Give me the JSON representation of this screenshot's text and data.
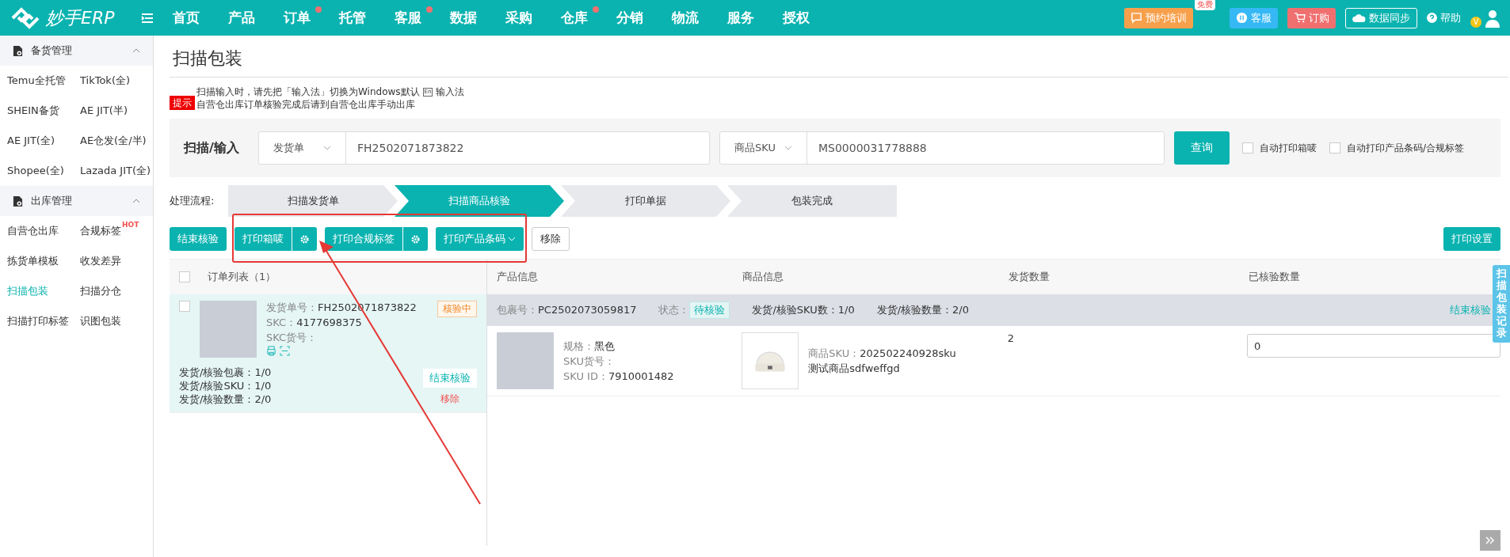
{
  "topbar": {
    "logo": "妙手ERP",
    "nav": [
      {
        "label": "首页",
        "dot": false
      },
      {
        "label": "产品",
        "dot": false
      },
      {
        "label": "订单",
        "dot": true
      },
      {
        "label": "托管",
        "dot": false
      },
      {
        "label": "客服",
        "dot": true
      },
      {
        "label": "数据",
        "dot": false
      },
      {
        "label": "采购",
        "dot": false
      },
      {
        "label": "仓库",
        "dot": true
      },
      {
        "label": "分销",
        "dot": false
      },
      {
        "label": "物流",
        "dot": false
      },
      {
        "label": "服务",
        "dot": false
      },
      {
        "label": "授权",
        "dot": false
      }
    ],
    "training": {
      "label": "预约培训",
      "badge": "免费"
    },
    "service": "客服",
    "order": "订购",
    "sync": "数据同步",
    "help": "帮助",
    "avatar_badge": "V"
  },
  "sidebar": [
    {
      "title": "备货管理",
      "expanded": true,
      "items": [
        {
          "label": "Temu全托管",
          "selected": false
        },
        {
          "label": "TikTok(全)",
          "selected": false
        },
        {
          "label": "SHEIN备货",
          "selected": false
        },
        {
          "label": "AE JIT(半)",
          "selected": false
        },
        {
          "label": "AE JIT(全)",
          "selected": false
        },
        {
          "label": "AE仓发(全/半)",
          "selected": false
        },
        {
          "label": "Shopee(全)",
          "selected": false
        },
        {
          "label": "Lazada JIT(全)",
          "selected": false
        }
      ]
    },
    {
      "title": "出库管理",
      "expanded": true,
      "items": [
        {
          "label": "自营仓出库",
          "selected": false
        },
        {
          "label": "合规标签",
          "selected": false,
          "badge": "HOT"
        },
        {
          "label": "拣货单模板",
          "selected": false
        },
        {
          "label": "收发差异",
          "selected": false
        },
        {
          "label": "扫描包装",
          "selected": true
        },
        {
          "label": "扫描分仓",
          "selected": false
        },
        {
          "label": "扫描打印标签",
          "selected": false
        },
        {
          "label": "识图包装",
          "selected": false
        }
      ]
    }
  ],
  "page_title": "扫描包装",
  "tip": {
    "badge": "提示",
    "line1_before": "扫描输入时，请先把「输入法」切换为Windows默认",
    "ime": "En",
    "line1_after": "输入法",
    "line2": "自营仓出库订单核验完成后请到自营仓出库手动出库"
  },
  "scan": {
    "label": "扫描/输入",
    "fields": [
      {
        "type": "发货单",
        "value": "FH2502071873822"
      },
      {
        "type": "商品SKU",
        "value": "MS0000031778888"
      }
    ],
    "query": "查询",
    "options": [
      {
        "label": "自动打印箱唛",
        "checked": false
      },
      {
        "label": "自动打印产品条码/合规标签",
        "checked": false
      }
    ]
  },
  "flow": {
    "label": "处理流程:",
    "steps": [
      {
        "label": "扫描发货单",
        "selected": false
      },
      {
        "label": "扫描商品核验",
        "selected": true
      },
      {
        "label": "打印单据",
        "selected": false
      },
      {
        "label": "包装完成",
        "selected": false
      }
    ]
  },
  "toolbar": [
    {
      "label": "结束核验",
      "kind": "plain"
    },
    {
      "label": "打印箱唛",
      "kind": "gear"
    },
    {
      "label": "打印合规标签",
      "kind": "gear"
    },
    {
      "label": "打印产品条码",
      "kind": "dropdown"
    },
    {
      "label": "移除",
      "kind": "outline"
    }
  ],
  "print_settings": "打印设置",
  "order_list": {
    "header": "订单列表（1）",
    "all_checked": false,
    "orders": [
      {
        "ship_no_label": "发货单号：",
        "ship_no": "FH2502071873822",
        "status": "核验中",
        "skc_label": "SKC：",
        "skc": "4177698375",
        "skc_no_label": "SKC货号：",
        "stats": [
          "发货/核验包裹：1/0",
          "发货/核验SKU：1/0",
          "发货/核验数量：2/0"
        ],
        "finish": "结束核验",
        "remove": "移除",
        "checked": false,
        "selected": true
      }
    ]
  },
  "table": {
    "columns": [
      "产品信息",
      "商品信息",
      "发货数量",
      "已核验数量"
    ],
    "package": {
      "no_label": "包裹号：",
      "no": "PC2502073059817",
      "status_label": "状态：",
      "status": "待核验",
      "sku_count": "发货/核验SKU数：1/0",
      "qty": "发货/核验数量：2/0",
      "finish": "结束核验"
    },
    "rows": [
      {
        "spec_label": "规格：",
        "spec": "黑色",
        "sku_no_label": "SKU货号：",
        "sku_id_label": "SKU ID：",
        "sku_id": "7910001482",
        "goods_sku_label": "商品SKU：",
        "goods_sku": "202502240928sku",
        "goods_name": "测试商品sdfweffgd",
        "ship_qty": "2",
        "checked_qty": "0"
      }
    ]
  },
  "side_tab": "扫描包装记录"
}
